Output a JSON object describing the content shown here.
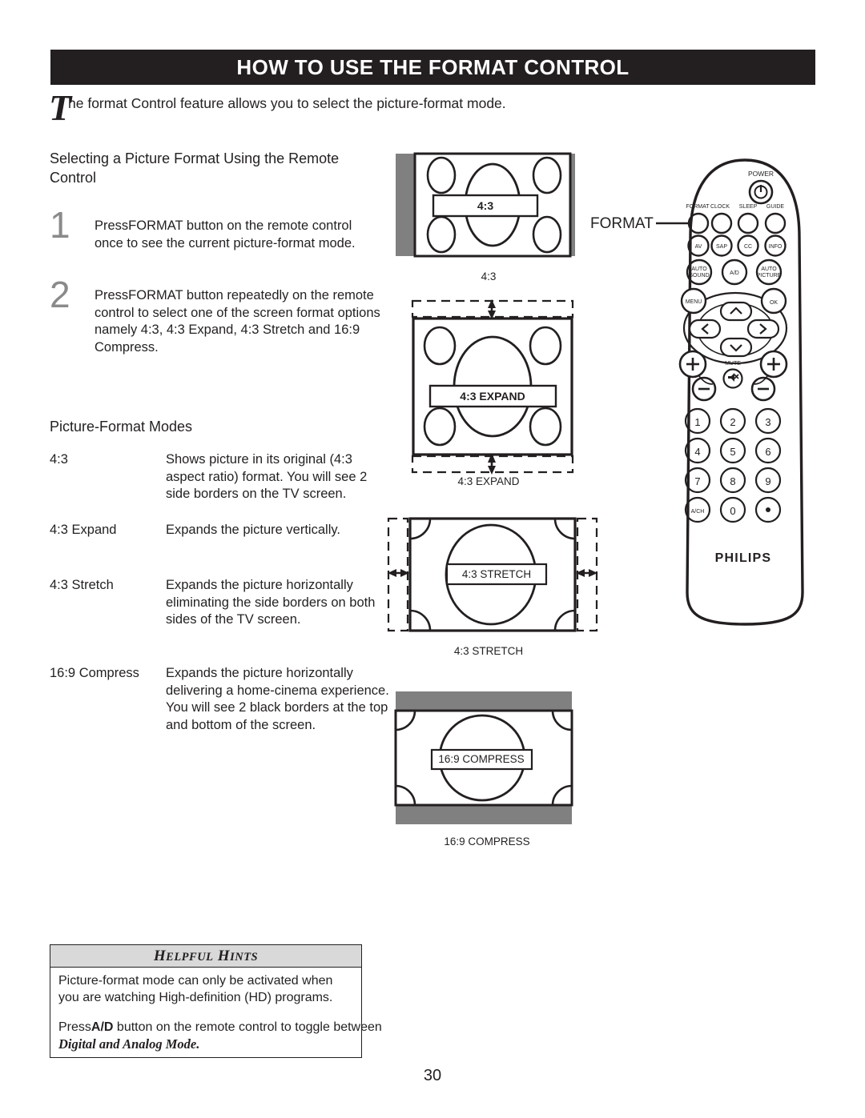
{
  "header": {
    "title": "HOW TO USE THE FORMAT CONTROL"
  },
  "intro": {
    "dropcap": "T",
    "text": "he format Control feature allows you to select the picture-format mode."
  },
  "sections": {
    "selecting_title": "Selecting a Picture Format Using the Remote Control",
    "modes_title": "Picture-Format Modes"
  },
  "steps": [
    {
      "number": "1",
      "text": "PressFORMAT  button on the remote control once to see the current picture-format mode."
    },
    {
      "number": "2",
      "text": "PressFORMAT  button repeatedly on the remote control to select one of the screen format options namely 4:3, 4:3 Expand, 4:3 Stretch and 16:9 Compress."
    }
  ],
  "modes": [
    {
      "label": "4:3",
      "description": "Shows picture in its original (4:3 aspect ratio) format. You will see 2 side borders on the TV screen."
    },
    {
      "label": "4:3 Expand",
      "description": "Expands the picture vertically."
    },
    {
      "label": "4:3 Stretch",
      "description": "Expands the picture horizontally eliminating the side borders on both sides of the TV screen."
    },
    {
      "label": "16:9 Compress",
      "description": "Expands the picture horizontally delivering a home-cinema experience. You will see 2 black borders at the top and bottom of the screen."
    }
  ],
  "diagrams": [
    {
      "screen_label": "4:3",
      "caption": "4:3"
    },
    {
      "screen_label": "4:3 EXPAND",
      "caption": "4:3 EXPAND"
    },
    {
      "screen_label": "4:3 STRETCH",
      "caption": "4:3 STRETCH"
    },
    {
      "screen_label": "16:9 COMPRESS",
      "caption": "16:9 COMPRESS"
    }
  ],
  "callout": {
    "format_label": "FORMAT"
  },
  "remote": {
    "brand": "PHILIPS",
    "power_label": "POWER",
    "mute_label": "MUTE",
    "row_top": [
      "FORMAT",
      "CLOCK",
      "SLEEP",
      "GUIDE"
    ],
    "row_av": [
      "AV",
      "SAP",
      "CC",
      "INFO"
    ],
    "row_auto": [
      "AUTO SOUND",
      "A/D",
      "AUTO PICTURE"
    ],
    "nav": {
      "menu": "MENU",
      "ok": "OK"
    },
    "keypad": [
      "1",
      "2",
      "3",
      "4",
      "5",
      "6",
      "7",
      "8",
      "9",
      "A/CH",
      "0",
      "·"
    ],
    "volume": {
      "plus": "+",
      "minus": "−"
    }
  },
  "hints": {
    "title_full": "HELPFUL HINTS",
    "title_h1": "H",
    "title_rest1": "ELPFUL",
    "title_h2": "H",
    "title_rest2": "INTS",
    "line1": "Picture-format mode can only be activated when you are watching High-definition (HD) programs.",
    "line2_a": "Press",
    "line2_b": "A/D",
    "line2_c": " button on the remote control to toggle between",
    "line2_d": "Digital and Analog Mode."
  },
  "page_number": "30",
  "colors": {
    "ink": "#231f20",
    "gray_bar": "#808080",
    "step_number": "#8a8a8a",
    "hint_header": "#d9d9d9"
  }
}
